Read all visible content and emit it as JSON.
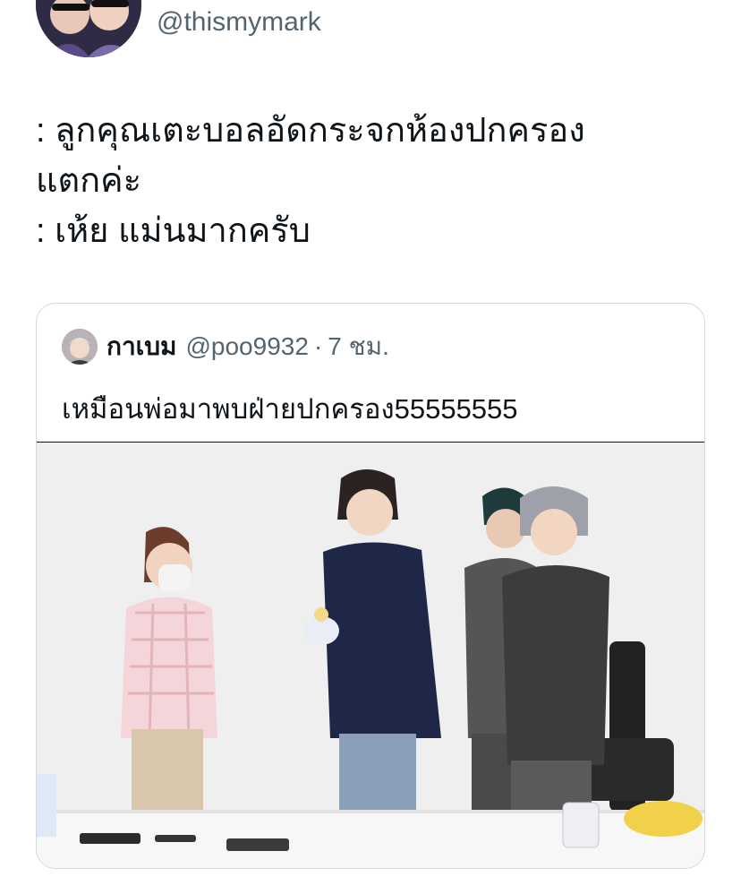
{
  "author": {
    "handle": "@thismymark",
    "avatar_icon": "avatar-photo-two-people"
  },
  "tweet": {
    "lines": [
      ": ลูกคุณเตะบอลอัดกระจกห้องปกครอง",
      "แตกค่ะ",
      ": เห้ย แม่นมากครับ"
    ]
  },
  "quoted_tweet": {
    "display_name": "กาเบม",
    "handle": "@poo9932",
    "separator": "·",
    "time": "7 ชม.",
    "text": "เหมือนพ่อมาพบฝ่ายปกครอง55555555",
    "avatar_icon": "avatar-photo-blond-person",
    "media_icon": "photo-people-standing-at-table"
  },
  "colors": {
    "text_primary": "#0f1419",
    "text_secondary": "#536471",
    "border": "#cfd9de"
  }
}
